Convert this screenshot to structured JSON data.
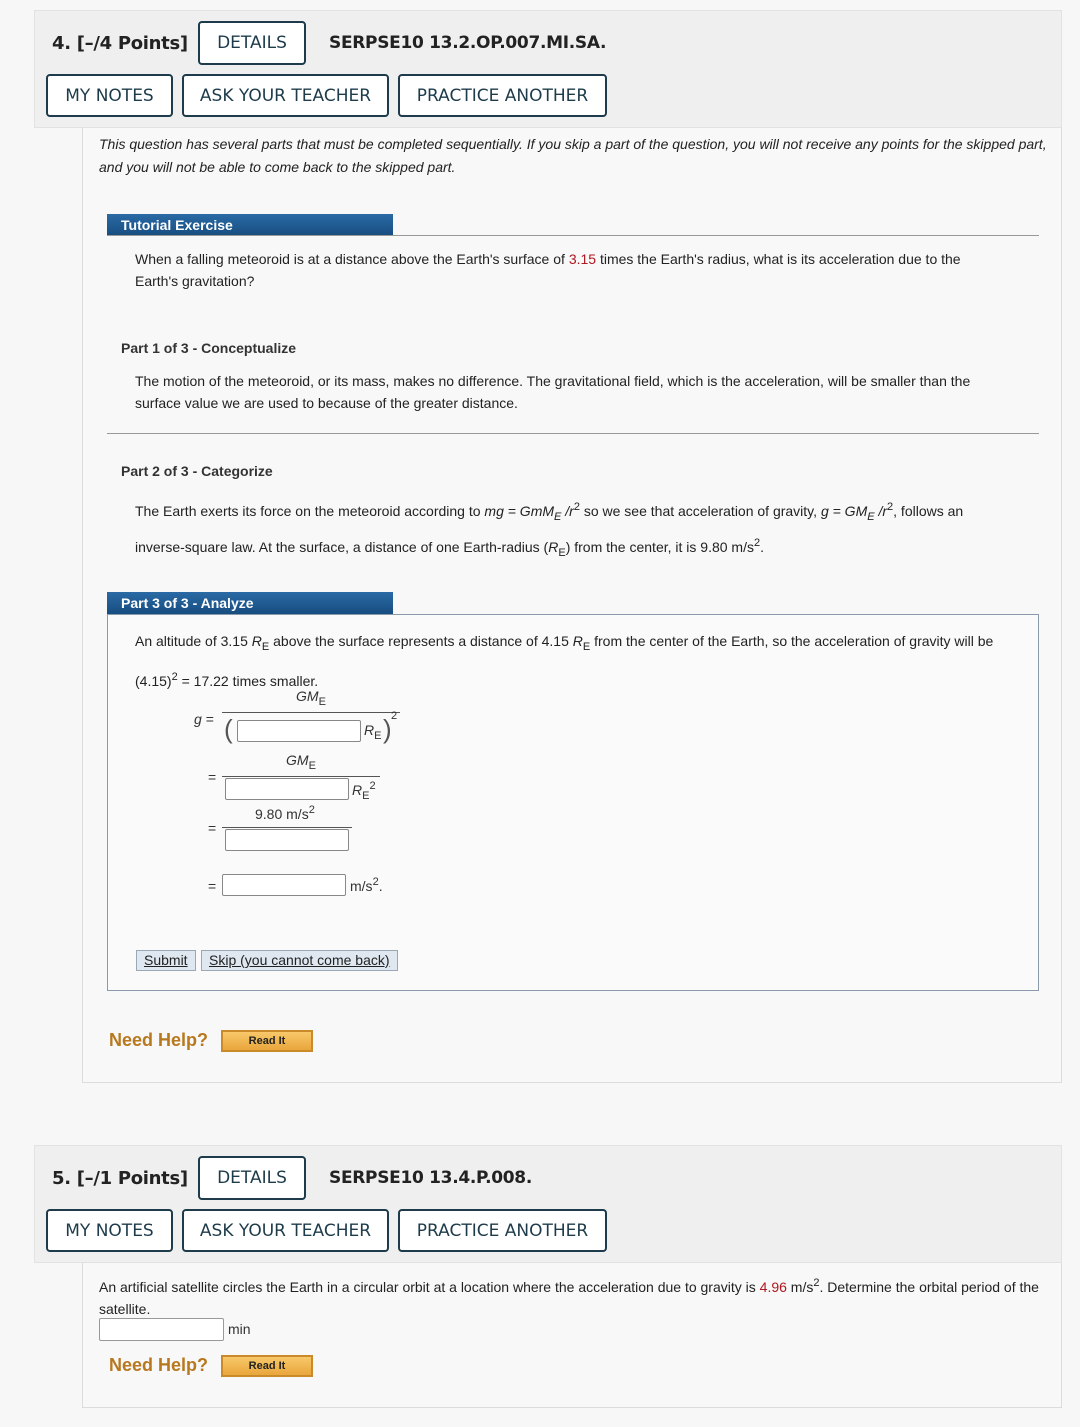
{
  "questions": [
    {
      "number_label": "4.  [–/4 Points]",
      "details_label": "DETAILS",
      "code": "SERPSE10 13.2.OP.007.MI.SA.",
      "my_notes_label": "MY NOTES",
      "ask_teacher_label": "ASK YOUR TEACHER",
      "practice_another_label": "PRACTICE ANOTHER",
      "intro": "This question has several parts that must be completed sequentially. If you skip a part of the question, you will not receive any points for the skipped part, and you will not be able to come back to the skipped part.",
      "tutorial_label": "Tutorial Exercise",
      "prompt_before": "When a falling meteoroid is at a distance above the Earth's surface of ",
      "prompt_value": "3.15",
      "prompt_after": " times the Earth's radius, what is its acceleration due to the Earth's gravitation?",
      "parts": [
        {
          "title": "Part 1 of 3 - Conceptualize",
          "text": "The motion of the meteoroid, or its mass, makes no difference. The gravitational field, which is the acceleration, will be smaller than the surface value we are used to because of the greater distance."
        },
        {
          "title": "Part 2 of 3 - Categorize",
          "text_1": "The Earth exerts its force on the meteoroid according to ",
          "eq_1": "mg = GmM",
          "eq_1_sub": "E",
          "eq_1_tail": " /r",
          "text_2": " so we see that acceleration of gravity, ",
          "eq_2": "g = GM",
          "eq_2_sub": "E",
          "eq_2_tail": " /r",
          "text_3": ", follows an inverse-square law. At the surface, a distance of one Earth-radius (",
          "re": "R",
          "re_sub": "E",
          "text_4": ") from the center, it is 9.80 m/s",
          "text_5": "."
        },
        {
          "title": "Part 3 of 3 - Analyze",
          "text_1": "An altitude of 3.15 ",
          "text_2": " above the surface represents a distance of 4.15 ",
          "text_3": " from the center of the Earth, so the acceleration of gravity will be (4.15)",
          "text_4": " = 17.22 times smaller.",
          "g_label": "g",
          "equals": "=",
          "gm": "GM",
          "sub_e": "E",
          "r": "R",
          "sq": "2",
          "numerator_3": "9.80 m/s",
          "unit": "m/s",
          "unit_end": ".",
          "input_values": [
            "",
            "",
            "",
            ""
          ]
        }
      ],
      "submit_label": "Submit",
      "skip_label": "Skip (you cannot come back)",
      "need_help_label": "Need Help?",
      "read_it_label": "Read It"
    },
    {
      "number_label": "5.  [–/1 Points]",
      "details_label": "DETAILS",
      "code": "SERPSE10 13.4.P.008.",
      "my_notes_label": "MY NOTES",
      "ask_teacher_label": "ASK YOUR TEACHER",
      "practice_another_label": "PRACTICE ANOTHER",
      "prompt_before": "An artificial satellite circles the Earth in a circular orbit at a location where the acceleration due to gravity is ",
      "prompt_value": "4.96",
      "prompt_unit": " m/s",
      "prompt_sup": "2",
      "prompt_after": ". Determine the orbital period of the satellite.",
      "answer_value": "",
      "answer_unit": "min",
      "need_help_label": "Need Help?",
      "read_it_label": "Read It"
    }
  ],
  "colors": {
    "accent_red": "#b0171f",
    "tab_blue": "#1f5c95",
    "help_orange": "#b8781e"
  }
}
